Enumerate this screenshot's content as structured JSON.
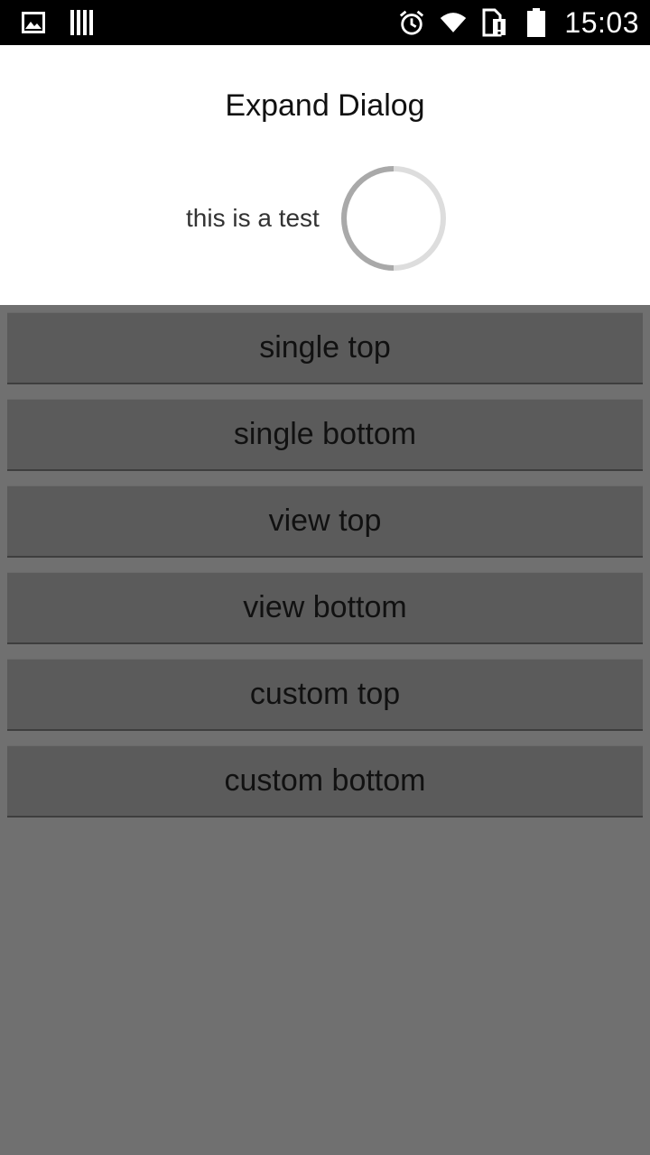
{
  "status_bar": {
    "time": "15:03",
    "left_icons": [
      "image-icon",
      "barcode-icon"
    ],
    "right_icons": [
      "alarm-icon",
      "wifi-icon",
      "sim-alert-icon",
      "battery-icon"
    ]
  },
  "dialog": {
    "title": "Expand Dialog",
    "message": "this is a test"
  },
  "buttons": [
    {
      "label": "single top"
    },
    {
      "label": "single bottom"
    },
    {
      "label": "view top"
    },
    {
      "label": "view bottom"
    },
    {
      "label": "custom top"
    },
    {
      "label": "custom bottom"
    }
  ]
}
